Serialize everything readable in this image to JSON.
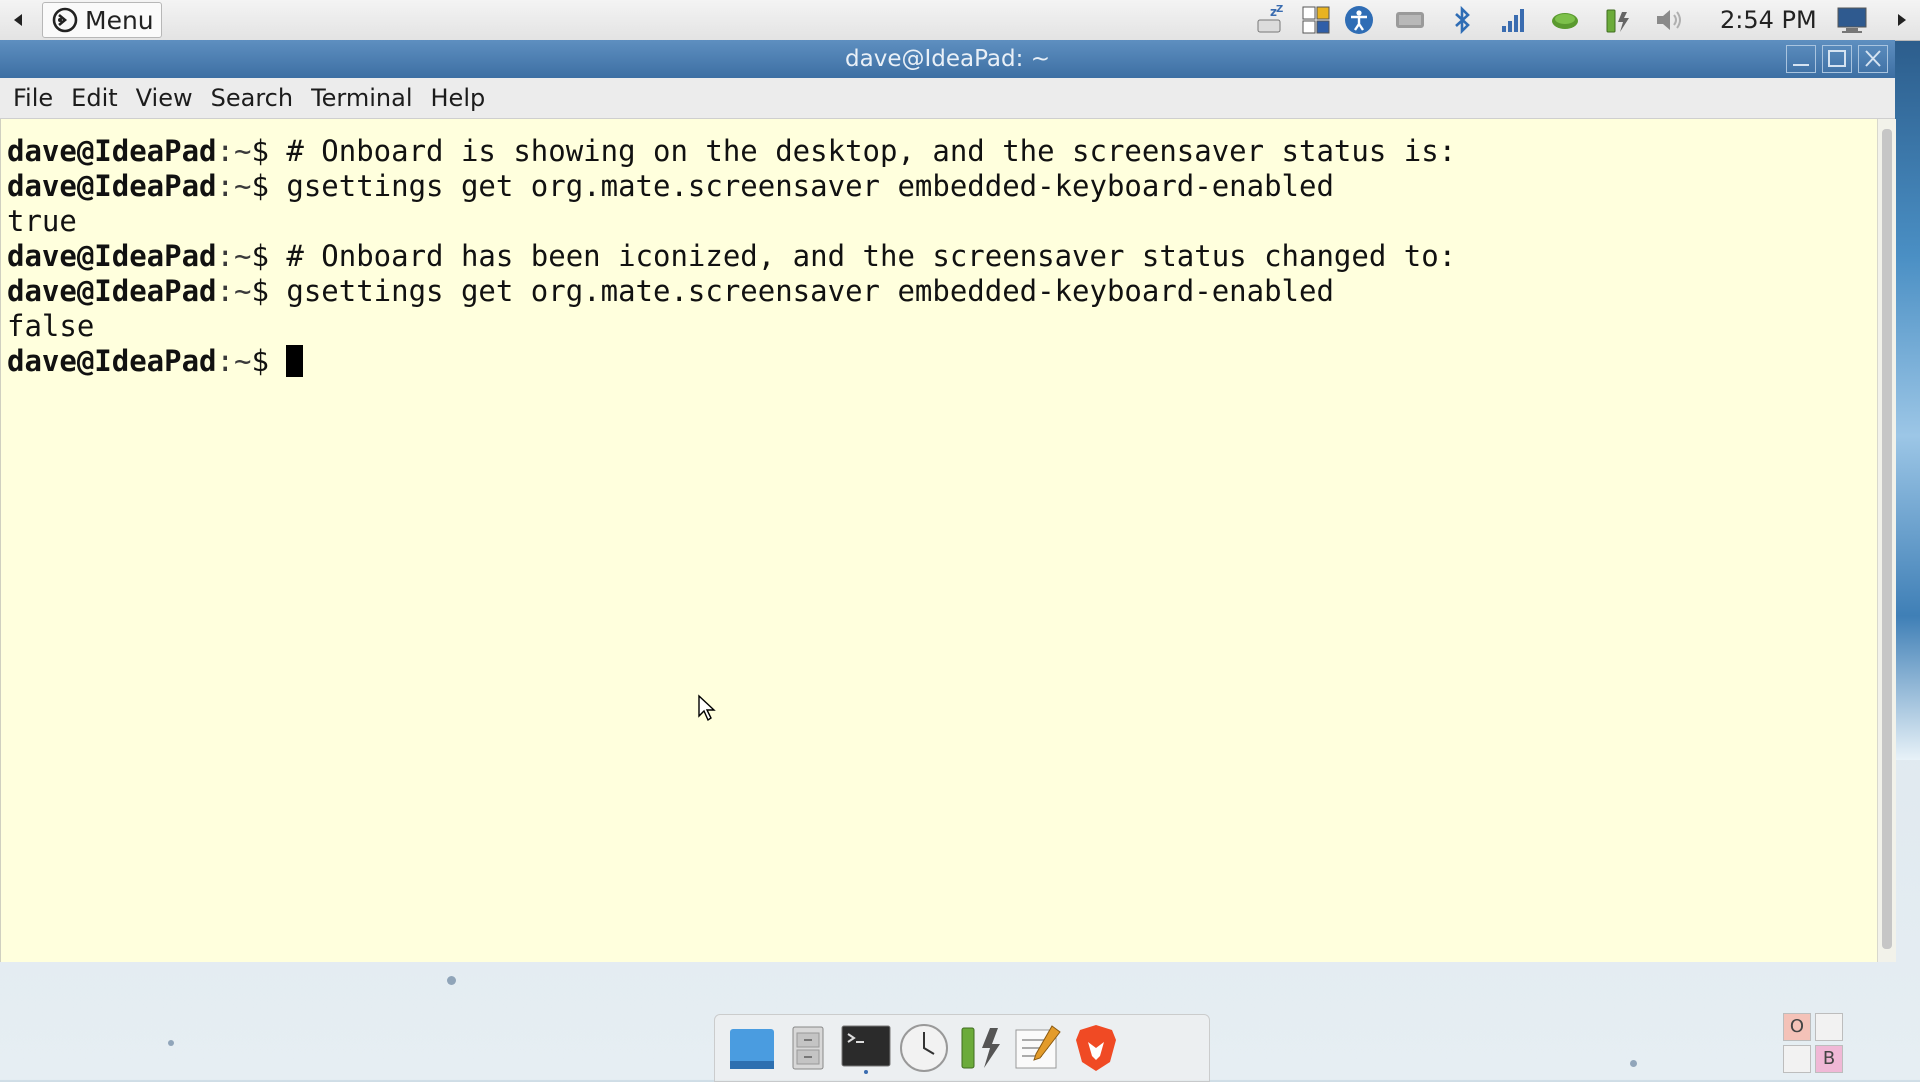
{
  "top_panel": {
    "menu_label": "Menu",
    "clock": "2:54 PM"
  },
  "window": {
    "title": "dave@IdeaPad: ~",
    "menu": [
      "File",
      "Edit",
      "View",
      "Search",
      "Terminal",
      "Help"
    ]
  },
  "terminal": {
    "prompt_user": "dave@IdeaPad",
    "prompt_path": ":~",
    "prompt_sym": "$ ",
    "lines": [
      {
        "type": "cmd",
        "text": "# Onboard is showing on the desktop, and the screensaver status is:"
      },
      {
        "type": "cmd",
        "text": "gsettings get org.mate.screensaver embedded-keyboard-enabled"
      },
      {
        "type": "out",
        "text": "true"
      },
      {
        "type": "cmd",
        "text": "# Onboard has been iconized, and the screensaver status changed to:"
      },
      {
        "type": "cmd",
        "text": "gsettings get org.mate.screensaver embedded-keyboard-enabled"
      },
      {
        "type": "out",
        "text": "false"
      },
      {
        "type": "cmd",
        "text": ""
      }
    ]
  },
  "workspaces": [
    "O",
    "",
    "",
    "B"
  ],
  "colors": {
    "terminal_bg": "#ffffdd",
    "titlebar": "#4a7cb0"
  }
}
